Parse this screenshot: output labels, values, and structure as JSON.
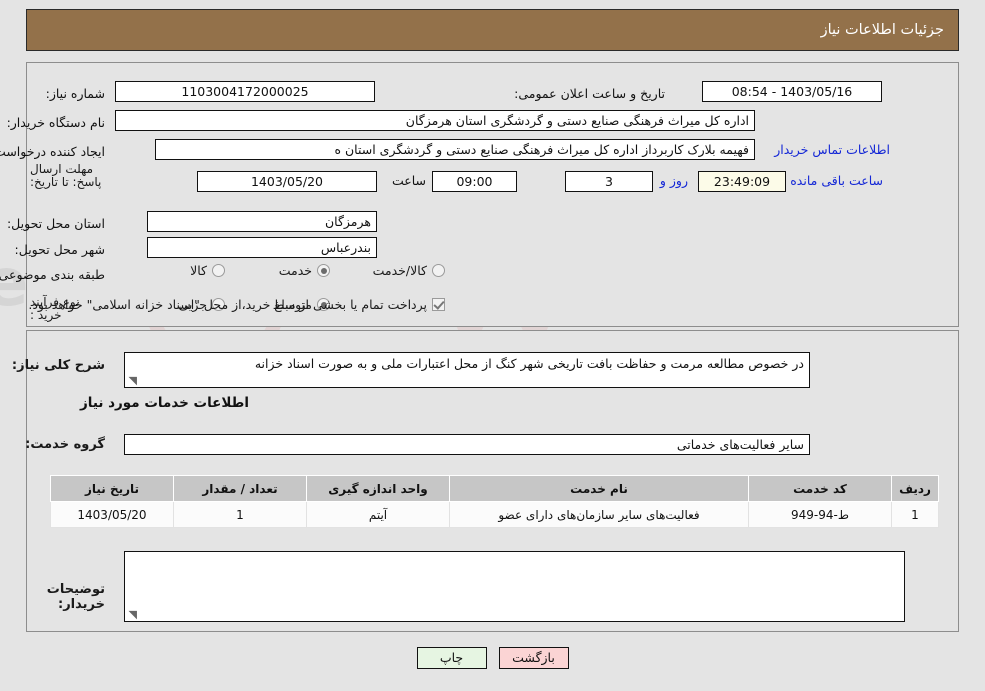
{
  "header": {
    "title": "جزئیات اطلاعات نیاز"
  },
  "form": {
    "need_number_label": "شماره نیاز:",
    "need_number_value": "1103004172000025",
    "announce_label": "تاریخ و ساعت اعلان عمومی:",
    "announce_value": "1403/05/16 - 08:54",
    "buyer_org_label": "نام دستگاه خریدار:",
    "buyer_org_value": "اداره کل میراث فرهنگی  صنایع دستی و گردشگری استان هرمزگان",
    "creator_label": "ایجاد کننده درخواست:",
    "creator_value": "فهیمه بلارک کاربرداز اداره کل میراث فرهنگی  صنایع دستی و گردشگری استان ه",
    "contact_link": "اطلاعات تماس خریدار",
    "deadline_label": "مهلت ارسال پاسخ: تا تاریخ:",
    "deadline_date": "1403/05/20",
    "deadline_time_label": "ساعت",
    "deadline_time": "09:00",
    "days_remaining": "3",
    "days_word": "روز و",
    "countdown": "23:49:09",
    "countdown_suffix": "ساعت باقی مانده",
    "province_label": "استان محل تحویل:",
    "province_value": "هرمزگان",
    "city_label": "شهر محل تحویل:",
    "city_value": "بندرعباس",
    "category_label": "طبقه بندی موضوعی:",
    "category_options": [
      "کالا",
      "خدمت",
      "کالا/خدمت"
    ],
    "category_selected": "خدمت",
    "process_label": "نوع فرآیند خرید :",
    "process_options": [
      "جزیی",
      "متوسط"
    ],
    "process_selected": "متوسط",
    "treasury_checkbox_label": "پرداخت تمام یا بخشی از مبلغ خرید،از محل \"اسناد خزانه اسلامی\" خواهد بود.",
    "treasury_checked": true
  },
  "description": {
    "label": "شرح کلی نیاز:",
    "value": "در خصوص مطالعه مرمت و حفاظت بافت تاریخی شهر کنگ از محل اعتبارات ملی و به صورت اسناد خزانه"
  },
  "services": {
    "section_title": "اطلاعات خدمات مورد نیاز",
    "group_label": "گروه خدمت:",
    "group_value": "سایر فعالیت‌های خدماتی",
    "columns": [
      "ردیف",
      "کد خدمت",
      "نام خدمت",
      "واحد اندازه گیری",
      "تعداد / مقدار",
      "تاریخ نیاز"
    ],
    "rows": [
      {
        "index": "1",
        "code": "ط-94-949",
        "name": "فعالیت‌های سایر سازمان‌های دارای عضو",
        "unit": "آیتم",
        "quantity": "1",
        "need_date": "1403/05/20"
      }
    ]
  },
  "buyer_notes": {
    "label": "توضیحات خریدار:",
    "value": ""
  },
  "buttons": {
    "back": "بازگشت",
    "print": "چاپ"
  },
  "colors": {
    "header_bar": "#93714a",
    "link": "#1427d6",
    "back_button": "#fbd4d4",
    "print_button": "#e6f5e2",
    "countdown_field": "#fcfbe8"
  }
}
